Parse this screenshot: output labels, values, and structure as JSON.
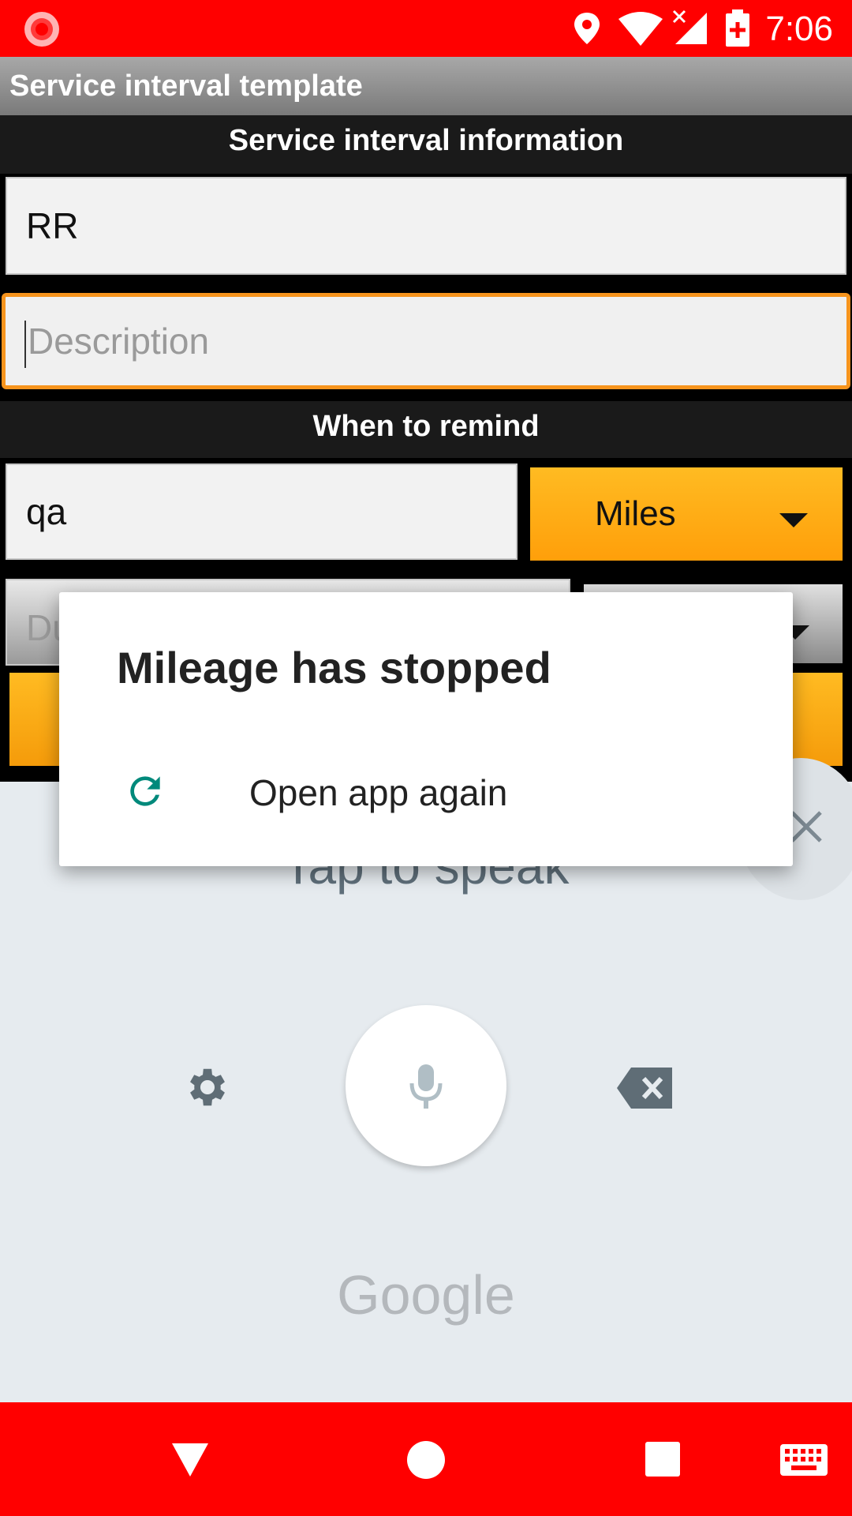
{
  "status_bar": {
    "time": "7:06",
    "icons": [
      "record-icon",
      "location-icon",
      "wifi-icon",
      "signal-icon",
      "battery-icon"
    ]
  },
  "action_bar": {
    "title": "Service interval template"
  },
  "section1": {
    "title": "Service interval information"
  },
  "name_field": {
    "value": "RR"
  },
  "description_field": {
    "placeholder": "Description"
  },
  "section2": {
    "title": "When to remind"
  },
  "distance_field": {
    "value": "qa"
  },
  "unit_spinner": {
    "selected": "Miles"
  },
  "duration_field": {
    "placeholder": "Du"
  },
  "voice_input": {
    "prompt": "Tap to speak",
    "brand": "Google"
  },
  "dialog": {
    "title": "Mileage has stopped",
    "action_label": "Open app again"
  },
  "colors": {
    "status_bar": "#ff0000",
    "accent_orange": "#ffa514",
    "focus_border": "#f7941d",
    "dialog_icon": "#00897b"
  }
}
